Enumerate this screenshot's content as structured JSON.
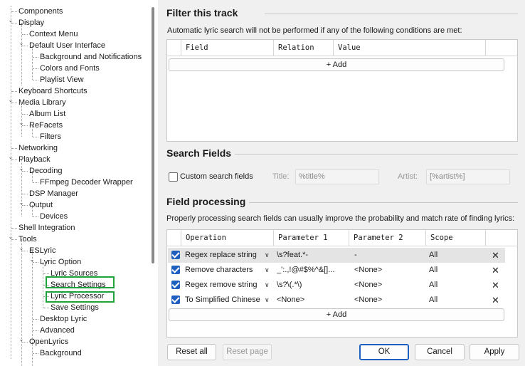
{
  "tree": {
    "items": [
      {
        "label": "Components",
        "depth": 0,
        "exp": ""
      },
      {
        "label": "Display",
        "depth": 0,
        "exp": "v"
      },
      {
        "label": "Context Menu",
        "depth": 1,
        "exp": ""
      },
      {
        "label": "Default User Interface",
        "depth": 1,
        "exp": "v"
      },
      {
        "label": "Background and Notifications",
        "depth": 2,
        "exp": ""
      },
      {
        "label": "Colors and Fonts",
        "depth": 2,
        "exp": ""
      },
      {
        "label": "Playlist View",
        "depth": 2,
        "exp": ""
      },
      {
        "label": "Keyboard Shortcuts",
        "depth": 0,
        "exp": ""
      },
      {
        "label": "Media Library",
        "depth": 0,
        "exp": "v"
      },
      {
        "label": "Album List",
        "depth": 1,
        "exp": ""
      },
      {
        "label": "ReFacets",
        "depth": 1,
        "exp": "v"
      },
      {
        "label": "Filters",
        "depth": 2,
        "exp": ""
      },
      {
        "label": "Networking",
        "depth": 0,
        "exp": ""
      },
      {
        "label": "Playback",
        "depth": 0,
        "exp": "v"
      },
      {
        "label": "Decoding",
        "depth": 1,
        "exp": "v"
      },
      {
        "label": "FFmpeg Decoder Wrapper",
        "depth": 2,
        "exp": ""
      },
      {
        "label": "DSP Manager",
        "depth": 1,
        "exp": ""
      },
      {
        "label": "Output",
        "depth": 1,
        "exp": "v"
      },
      {
        "label": "Devices",
        "depth": 2,
        "exp": ""
      },
      {
        "label": "Shell Integration",
        "depth": 0,
        "exp": ""
      },
      {
        "label": "Tools",
        "depth": 0,
        "exp": "v"
      },
      {
        "label": "ESLyric",
        "depth": 1,
        "exp": "v"
      },
      {
        "label": "Lyric Option",
        "depth": 2,
        "exp": "v"
      },
      {
        "label": "Lyric Sources",
        "depth": 3,
        "exp": ""
      },
      {
        "label": "Search Settings",
        "depth": 3,
        "exp": ""
      },
      {
        "label": "Lyric Processor",
        "depth": 3,
        "exp": ""
      },
      {
        "label": "Save Settings",
        "depth": 3,
        "exp": ""
      },
      {
        "label": "Desktop Lyric",
        "depth": 2,
        "exp": ""
      },
      {
        "label": "Advanced",
        "depth": 2,
        "exp": ""
      },
      {
        "label": "OpenLyrics",
        "depth": 1,
        "exp": "v"
      },
      {
        "label": "Background",
        "depth": 2,
        "exp": ""
      }
    ]
  },
  "filter": {
    "title": "Filter this track",
    "description": "Automatic lyric search will not be performed if any of the following conditions are met:",
    "columns": [
      "Field",
      "Relation",
      "Value"
    ],
    "add_label": "+ Add"
  },
  "search_fields": {
    "title": "Search Fields",
    "custom_label": "Custom search fields",
    "title_label": "Title:",
    "title_value": "%title%",
    "artist_label": "Artist:",
    "artist_value": "[%artist%]"
  },
  "processing": {
    "title": "Field processing",
    "description": "Properly processing search fields can usually improve the probability and match rate of finding lyrics:",
    "columns": [
      "Operation",
      "Parameter 1",
      "Parameter 2",
      "Scope"
    ],
    "rows": [
      {
        "operation": "Regex replace string",
        "p1": "\\s?feat.*-",
        "p2": "-",
        "scope": "All"
      },
      {
        "operation": "Remove characters",
        "p1": "_':.,!@#$%^&[]...",
        "p2": "<None>",
        "scope": "All"
      },
      {
        "operation": "Regex remove string",
        "p1": "\\s?\\(.*\\)",
        "p2": "<None>",
        "scope": "All"
      },
      {
        "operation": "To Simplified Chinese",
        "p1": "<None>",
        "p2": "<None>",
        "scope": "All"
      }
    ],
    "add_label": "+ Add",
    "dropdown_glyph": "∨",
    "delete_glyph": "✕"
  },
  "buttons": {
    "reset_all": "Reset all",
    "reset_page": "Reset page",
    "ok": "OK",
    "cancel": "Cancel",
    "apply": "Apply"
  },
  "colors": {
    "accent": "#1f5fbf",
    "highlight_box": "#1ea33a"
  }
}
